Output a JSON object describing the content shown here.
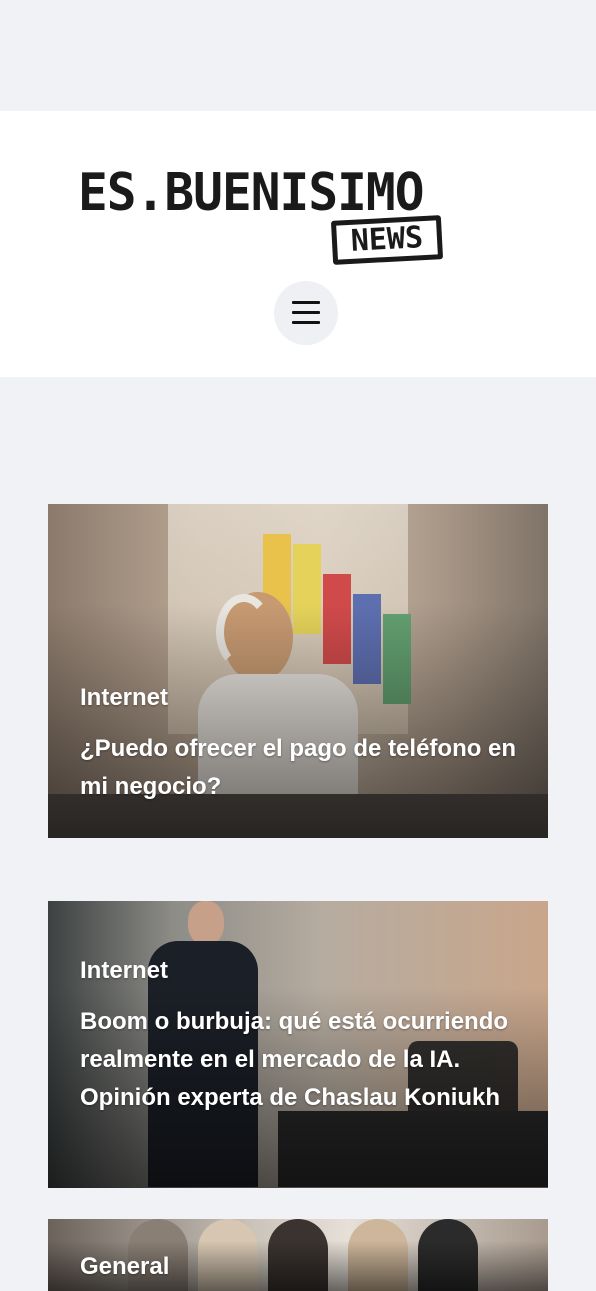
{
  "header": {
    "logo_main": "ES.BUENISIMO",
    "logo_sub": "NEWS",
    "menu_icon": "hamburger-icon"
  },
  "articles": [
    {
      "category": "Internet",
      "title": "¿Puedo ofrecer el pago de teléfono en mi negocio?"
    },
    {
      "category": "Internet",
      "title": "Boom o burbuja: qué está ocurriendo realmente en el mercado de la IA. Opinión experta de Chaslau Koniukh"
    },
    {
      "category": "General",
      "title": ""
    }
  ]
}
